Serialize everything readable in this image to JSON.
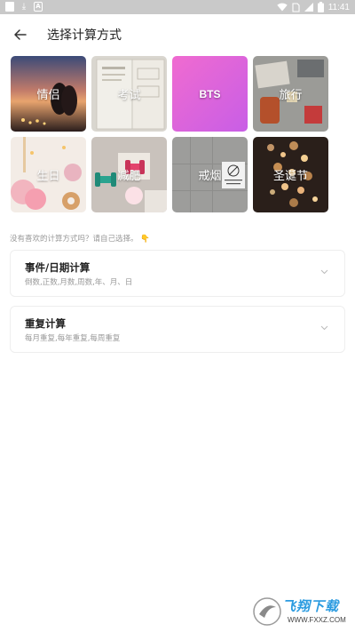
{
  "status_bar": {
    "time": "11:41"
  },
  "header": {
    "title": "选择计算方式"
  },
  "templates": [
    {
      "label": "情侣"
    },
    {
      "label": "考试"
    },
    {
      "label": "BTS"
    },
    {
      "label": "旅行"
    },
    {
      "label": "生日"
    },
    {
      "label": "减肥"
    },
    {
      "label": "戒烟"
    },
    {
      "label": "圣诞节"
    }
  ],
  "hint": "没有喜欢的计算方式吗？请自己选择。",
  "cards": [
    {
      "title": "事件/日期计算",
      "subtitle": "倒数,正数,月数,周数,年、月、日"
    },
    {
      "title": "重复计算",
      "subtitle": "每月重复,每年重复,每周重复"
    }
  ],
  "watermark": {
    "brand": "飞翔下载",
    "url": "WWW.FXXZ.COM"
  },
  "colors": {
    "status_bar": "#c9c9c9",
    "bts_gradient_start": "#f06bd0",
    "bts_gradient_end": "#c85ee6",
    "hint_text": "#999999"
  },
  "icons": {
    "back": "arrow-left-icon",
    "chevron": "chevron-down-icon"
  }
}
